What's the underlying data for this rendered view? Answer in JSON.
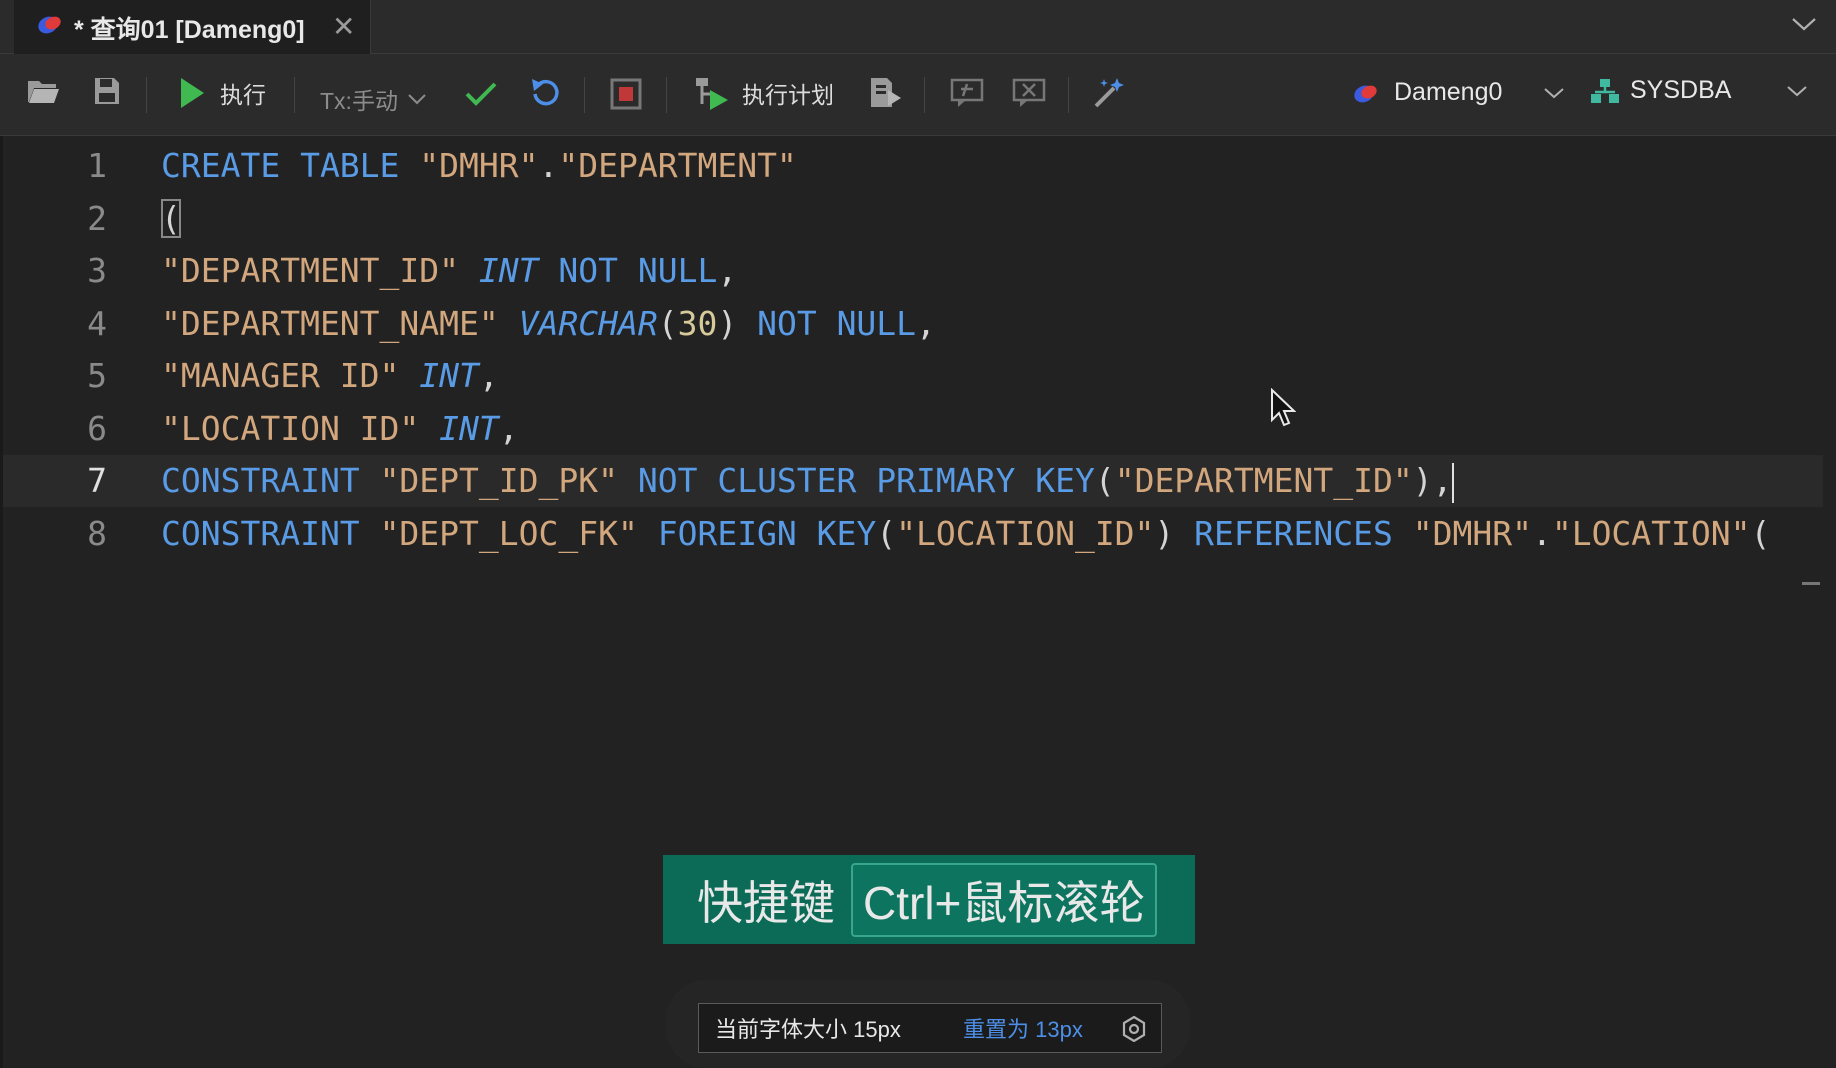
{
  "tab": {
    "title": "* 查询01 [Dameng0]",
    "close": "✕"
  },
  "toolbar": {
    "execute_label": "执行",
    "tx_label": "Tx:手动",
    "plan_label": "执行计划",
    "connection_label": "Dameng0",
    "user_label": "SYSDBA"
  },
  "editor": {
    "lines": [
      {
        "n": "1",
        "parts": [
          [
            "kw",
            "CREATE TABLE"
          ],
          [
            "pn",
            " "
          ],
          [
            "str",
            "\"DMHR\""
          ],
          [
            "pn",
            "."
          ],
          [
            "str",
            "\"DEPARTMENT\""
          ]
        ]
      },
      {
        "n": "2",
        "parts": [
          [
            "box",
            "("
          ]
        ]
      },
      {
        "n": "3",
        "parts": [
          [
            "str",
            "\"DEPARTMENT_ID\""
          ],
          [
            "pn",
            " "
          ],
          [
            "ty",
            "INT"
          ],
          [
            "pn",
            " "
          ],
          [
            "kw",
            "NOT NULL"
          ],
          [
            "pn",
            ","
          ]
        ]
      },
      {
        "n": "4",
        "parts": [
          [
            "str",
            "\"DEPARTMENT_NAME\""
          ],
          [
            "pn",
            " "
          ],
          [
            "ty",
            "VARCHAR"
          ],
          [
            "pn",
            "("
          ],
          [
            "num",
            "30"
          ],
          [
            "pn",
            ") "
          ],
          [
            "kw",
            "NOT NULL"
          ],
          [
            "pn",
            ","
          ]
        ]
      },
      {
        "n": "5",
        "parts": [
          [
            "str",
            "\"MANAGER ID\""
          ],
          [
            "pn",
            " "
          ],
          [
            "ty",
            "INT"
          ],
          [
            "pn",
            ","
          ]
        ]
      },
      {
        "n": "6",
        "parts": [
          [
            "str",
            "\"LOCATION ID\""
          ],
          [
            "pn",
            " "
          ],
          [
            "ty",
            "INT"
          ],
          [
            "pn",
            ","
          ]
        ]
      },
      {
        "n": "7",
        "parts": [
          [
            "kw",
            "CONSTRAINT"
          ],
          [
            "pn",
            " "
          ],
          [
            "str",
            "\"DEPT_ID_PK\""
          ],
          [
            "pn",
            " "
          ],
          [
            "kw",
            "NOT CLUSTER PRIMARY KEY"
          ],
          [
            "pn",
            "("
          ],
          [
            "str",
            "\"DEPARTMENT_ID\""
          ],
          [
            "pn",
            "),"
          ]
        ],
        "active": true
      },
      {
        "n": "8",
        "parts": [
          [
            "kw",
            "CONSTRAINT"
          ],
          [
            "pn",
            " "
          ],
          [
            "str",
            "\"DEPT_LOC_FK\""
          ],
          [
            "pn",
            " "
          ],
          [
            "kw",
            "FOREIGN KEY"
          ],
          [
            "pn",
            "("
          ],
          [
            "str",
            "\"LOCATION_ID\""
          ],
          [
            "pn",
            ") "
          ],
          [
            "kw",
            "REFERENCES"
          ],
          [
            "pn",
            " "
          ],
          [
            "str",
            "\"DMHR\""
          ],
          [
            "pn",
            "."
          ],
          [
            "str",
            "\"LOCATION\""
          ],
          [
            "pn",
            "("
          ]
        ]
      }
    ]
  },
  "shortcut": {
    "label": "快捷键",
    "keys": "Ctrl+鼠标滚轮"
  },
  "font_size": {
    "current": "当前字体大小 15px",
    "reset": "重置为 13px"
  },
  "colors": {
    "keyword": "#5a9be6",
    "string": "#d3a77e",
    "number": "#d6c99a",
    "banner": "#0b6b57",
    "link": "#4d8fe8"
  },
  "icons": [
    "app-logo-icon",
    "close-icon",
    "chevron-down-icon",
    "folder-open-icon",
    "save-icon",
    "play-icon",
    "check-icon",
    "undo-icon",
    "stop-icon",
    "plan-icon",
    "export-icon",
    "comment-icon",
    "uncomment-icon",
    "magic-wand-icon",
    "database-icon",
    "user-icon",
    "gear-icon",
    "mouse-cursor-icon"
  ]
}
